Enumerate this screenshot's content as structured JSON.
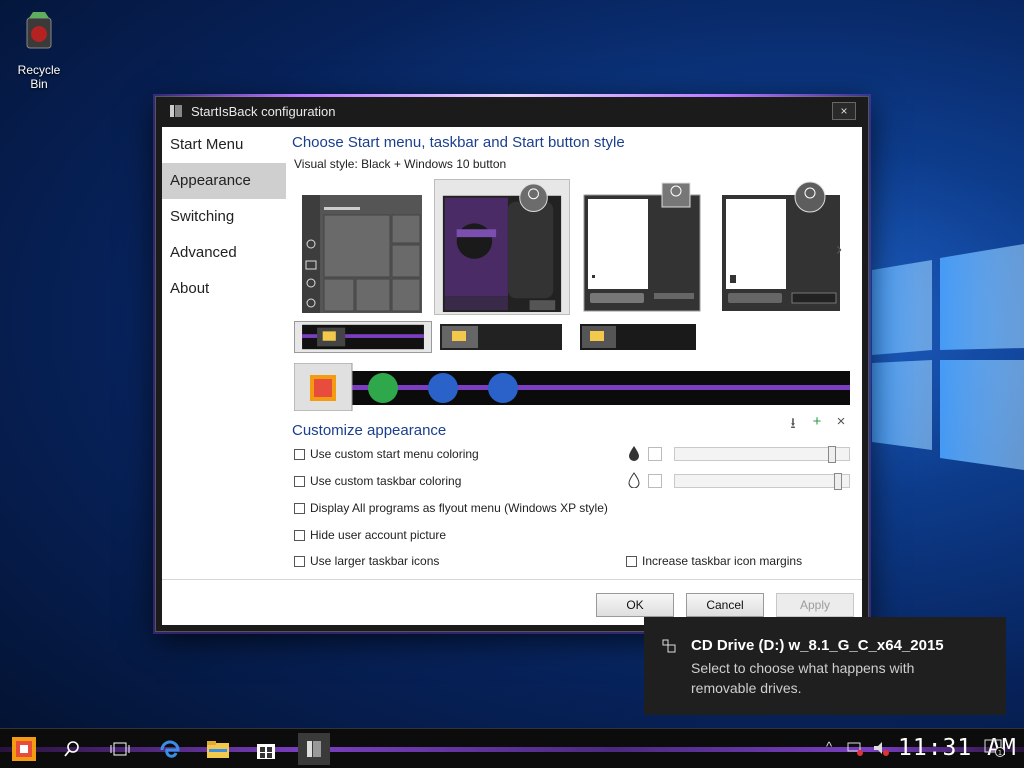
{
  "desktop": {
    "icons": [
      {
        "label": "Recycle Bin",
        "icon": "recycle-bin-icon"
      }
    ]
  },
  "window": {
    "title": "StartIsBack configuration",
    "close_label": "×"
  },
  "nav": {
    "items": [
      {
        "label": "Start Menu",
        "active": false
      },
      {
        "label": "Appearance",
        "active": true
      },
      {
        "label": "Switching",
        "active": false
      },
      {
        "label": "Advanced",
        "active": false
      },
      {
        "label": "About",
        "active": false
      }
    ]
  },
  "appearance": {
    "heading": "Choose Start menu, taskbar and Start button style",
    "visual_style_label": "Visual style:",
    "visual_style_value": "Black + Windows 10 button",
    "next_arrow": "›",
    "customize_heading": "Customize appearance",
    "tool_icons": {
      "download": "⭳",
      "add": "+",
      "remove": "×"
    },
    "options": {
      "custom_start_color": "Use custom start menu coloring",
      "custom_taskbar_color": "Use custom taskbar coloring",
      "flyout_menu": "Display All programs as flyout menu (Windows XP style)",
      "hide_user_picture": "Hide user account picture",
      "larger_icons": "Use larger taskbar icons",
      "icon_margins": "Increase taskbar icon margins"
    },
    "sliders": {
      "opacity_start": 0.92,
      "opacity_taskbar": 0.96
    }
  },
  "buttons": {
    "ok": "OK",
    "cancel": "Cancel",
    "apply": "Apply"
  },
  "toast": {
    "title": "CD Drive (D:) w_8.1_G_C_x64_2015",
    "body": "Select to choose what happens with removable drives."
  },
  "taskbar": {
    "clock": "11:31 AM",
    "notification_count": "1"
  },
  "colors": {
    "accent": "#1b3f8f",
    "purple": "#7a3fc0"
  }
}
